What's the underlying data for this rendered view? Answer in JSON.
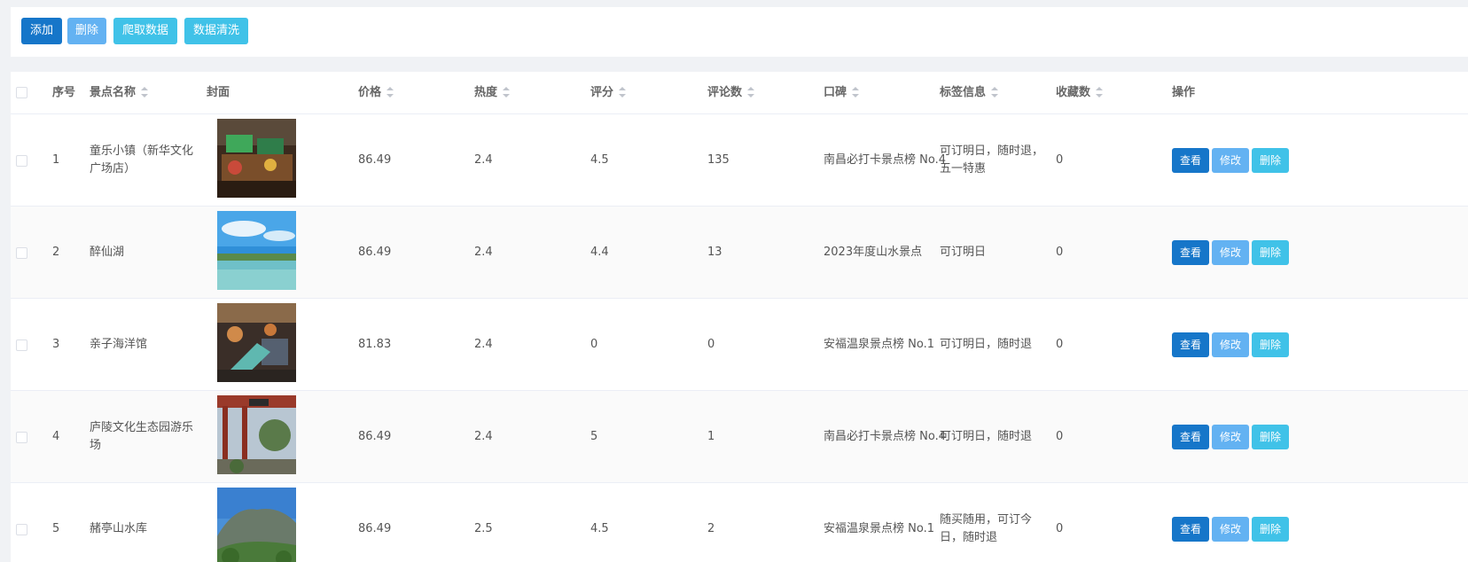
{
  "toolbar": {
    "add": "添加",
    "delete": "删除",
    "crawl": "爬取数据",
    "clean": "数据清洗"
  },
  "table": {
    "headers": {
      "index": "序号",
      "name": "景点名称",
      "cover": "封面",
      "price": "价格",
      "heat": "热度",
      "score": "评分",
      "comments": "评论数",
      "reputation": "口碑",
      "tags": "标签信息",
      "favorites": "收藏数",
      "actions": "操作"
    },
    "action_labels": {
      "view": "查看",
      "edit": "修改",
      "delete": "删除"
    },
    "rows": [
      {
        "index": "1",
        "name": "童乐小镇（新华文化广场店）",
        "price": "86.49",
        "heat": "2.4",
        "score": "4.5",
        "comments": "135",
        "reputation": "南昌必打卡景点榜 No.4",
        "tags": "可订明日，随时退，五一特惠",
        "favorites": "0"
      },
      {
        "index": "2",
        "name": "醉仙湖",
        "price": "86.49",
        "heat": "2.4",
        "score": "4.4",
        "comments": "13",
        "reputation": "2023年度山水景点",
        "tags": "可订明日",
        "favorites": "0"
      },
      {
        "index": "3",
        "name": "亲子海洋馆",
        "price": "81.83",
        "heat": "2.4",
        "score": "0",
        "comments": "0",
        "reputation": "安福温泉景点榜 No.1",
        "tags": "可订明日，随时退",
        "favorites": "0"
      },
      {
        "index": "4",
        "name": "庐陵文化生态园游乐场",
        "price": "86.49",
        "heat": "2.4",
        "score": "5",
        "comments": "1",
        "reputation": "南昌必打卡景点榜 No.4",
        "tags": "可订明日，随时退",
        "favorites": "0"
      },
      {
        "index": "5",
        "name": "赭亭山水库",
        "price": "86.49",
        "heat": "2.5",
        "score": "4.5",
        "comments": "2",
        "reputation": "安福温泉景点榜 No.1",
        "tags": "随买随用，可订今日，随时退",
        "favorites": "0"
      }
    ]
  },
  "colors": {
    "primary": "#1676c9",
    "light_blue": "#63b2f2",
    "cyan": "#40c2e8"
  }
}
